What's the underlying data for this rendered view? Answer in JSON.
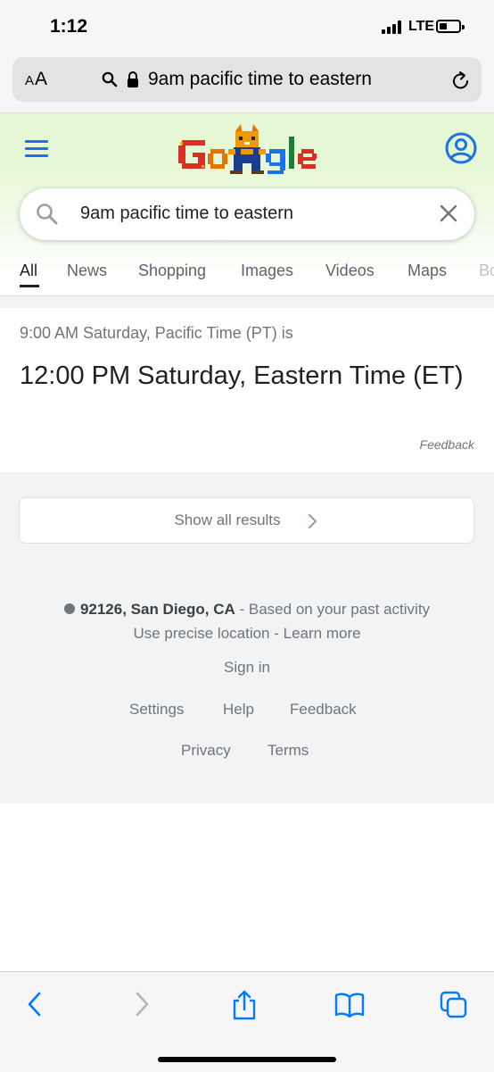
{
  "status_bar": {
    "time": "1:12",
    "network": "LTE",
    "battery_level": 0.3
  },
  "browser": {
    "text_size_button": {
      "small": "A",
      "large": "A"
    },
    "url": "9am pacific time to eastern",
    "icons": [
      "search-icon",
      "lock-icon",
      "reload-icon"
    ]
  },
  "google": {
    "search_query": "9am pacific time to eastern",
    "tabs": [
      "All",
      "News",
      "Shopping",
      "Images",
      "Videos",
      "Maps",
      "Bo"
    ],
    "active_tab": "All"
  },
  "answer": {
    "source": "9:00 AM Saturday, Pacific Time (PT) is",
    "result": "12:00 PM Saturday, Eastern Time (ET)",
    "feedback": "Feedback"
  },
  "show_all_results": "Show all results",
  "footer": {
    "location_place": "92126, San Diego, CA",
    "location_suffix": " - Based on your past activity",
    "use_precise_location": "Use precise location",
    "separator": " - ",
    "learn_more": "Learn more",
    "sign_in": "Sign in",
    "settings": "Settings",
    "help": "Help",
    "feedback": "Feedback",
    "privacy": "Privacy",
    "terms": "Terms"
  },
  "colors": {
    "google_blue": "#1a73e8",
    "header_green": "#e6f7d6",
    "safari_blue": "#007aff",
    "muted_text": "#70757a"
  },
  "toolbar_icons": [
    "back-icon",
    "forward-icon",
    "share-icon",
    "bookmarks-icon",
    "tabs-icon"
  ]
}
